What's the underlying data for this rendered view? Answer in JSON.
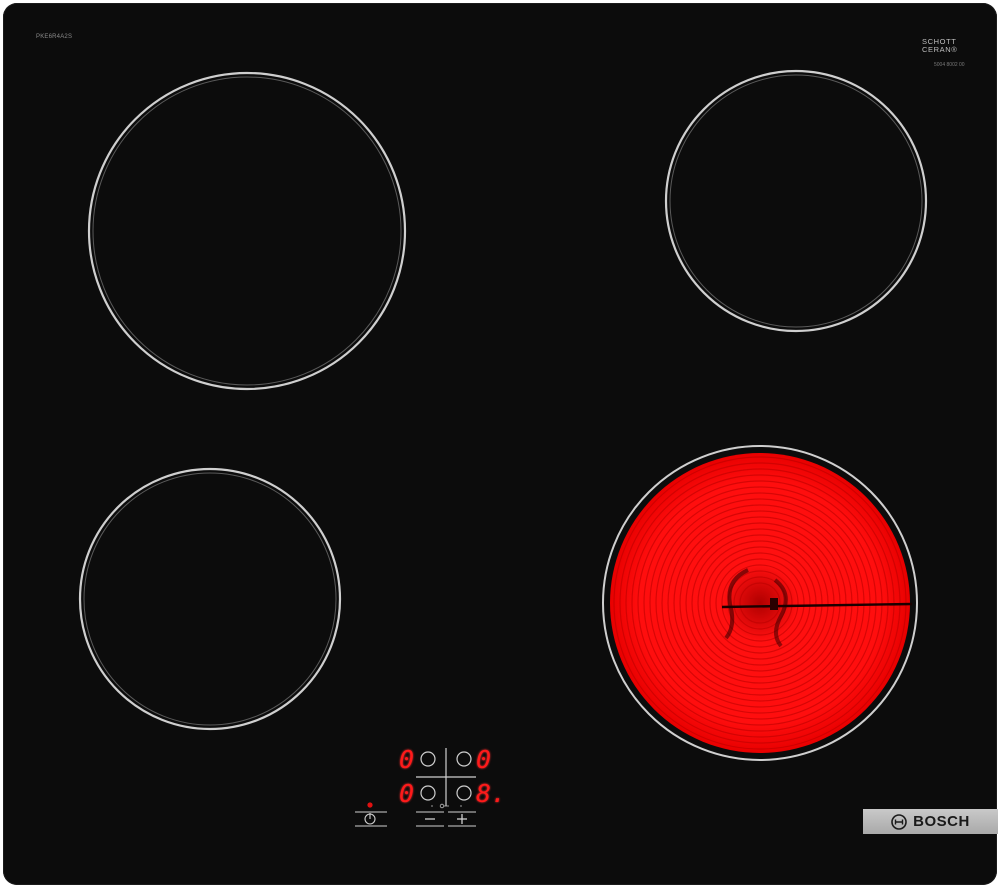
{
  "hob": {
    "model_number": "PKE6R4A2S",
    "glass_brand_line1": "SCHOTT",
    "glass_brand_line2": "CERAN®",
    "glass_code": "5004 8002 00",
    "brand": "BOSCH"
  },
  "zones": [
    {
      "name": "front-left",
      "state": "off"
    },
    {
      "name": "back-left",
      "state": "off"
    },
    {
      "name": "back-right",
      "state": "off"
    },
    {
      "name": "front-right",
      "state": "heating"
    }
  ],
  "displays": {
    "top_left": "0",
    "top_right": "0",
    "bottom_left": "0",
    "bottom_right": "8."
  },
  "controls": {
    "power_icon": "power-icon",
    "minus_icon": "minus-icon",
    "plus_icon": "plus-icon",
    "lock_icon": "key-lock-icon"
  },
  "colors": {
    "glass": "#0c0c0c",
    "ring": "#cfcfcf",
    "heat": "#ff1010",
    "display": "#ff1a1a",
    "brand_plate": "#bdbdbd"
  }
}
